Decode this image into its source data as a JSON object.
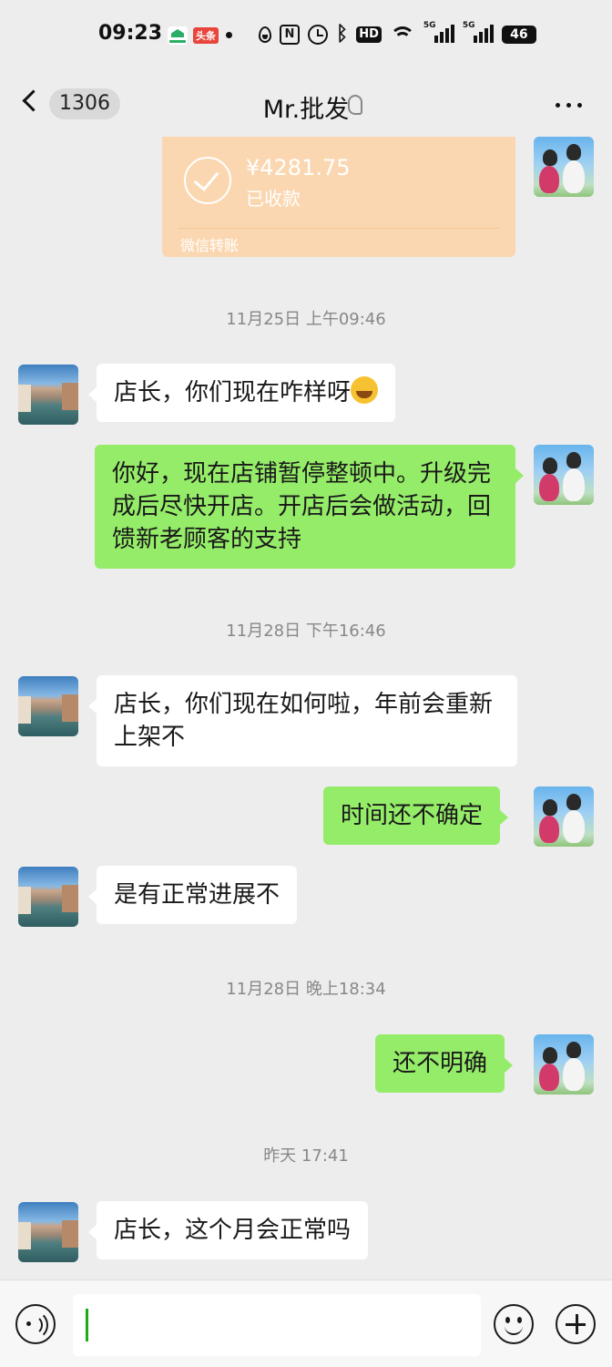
{
  "status_bar": {
    "time": "09:23",
    "app_badge": "头条",
    "hd_label": "HD",
    "network_1": "5G",
    "network_2": "5G",
    "battery": "46"
  },
  "header": {
    "unread_count": "1306",
    "title": "Mr.批发",
    "icons": [
      "back-icon",
      "ear-icon",
      "more-icon"
    ]
  },
  "transfer": {
    "amount": "¥4281.75",
    "status": "已收款",
    "footer": "微信转账"
  },
  "messages": [
    {
      "type": "time",
      "text": "11月25日 上午09:46"
    },
    {
      "type": "in",
      "text": "店长，你们现在咋样呀",
      "emoji": "laughing-tears-emoji"
    },
    {
      "type": "out",
      "text": "你好，现在店铺暂停整顿中。升级完成后尽快开店。开店后会做活动，回馈新老顾客的支持"
    },
    {
      "type": "time",
      "text": "11月28日 下午16:46"
    },
    {
      "type": "in",
      "text": "店长，你们现在如何啦，年前会重新上架不"
    },
    {
      "type": "out",
      "text": "时间还不确定"
    },
    {
      "type": "in",
      "text": "是有正常进展不"
    },
    {
      "type": "time",
      "text": "11月28日 晚上18:34"
    },
    {
      "type": "out",
      "text": "还不明确"
    },
    {
      "type": "time",
      "text": "昨天 17:41"
    },
    {
      "type": "in",
      "text": "店长，这个月会正常吗"
    }
  ],
  "input_bar": {
    "value": "",
    "icons": [
      "voice-icon",
      "emoji-icon",
      "plus-icon"
    ]
  },
  "colors": {
    "background": "#ededed",
    "incoming_bubble": "#ffffff",
    "outgoing_bubble": "#95ec69",
    "transfer_card": "#fbd7b1"
  }
}
